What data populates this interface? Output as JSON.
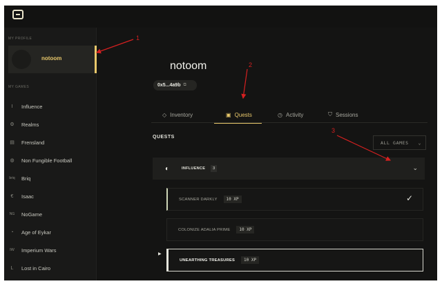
{
  "app": {
    "logo_icon": "game-console-icon"
  },
  "sidebar": {
    "profile_section_label": "MY PROFILE",
    "games_section_label": "MY GAMES",
    "profile": {
      "name": "notoom"
    },
    "games": [
      {
        "label": "Influence",
        "icon": "I"
      },
      {
        "label": "Realms",
        "icon": "⚙"
      },
      {
        "label": "Frensland",
        "icon": "▤"
      },
      {
        "label": "Non Fungible Football",
        "icon": "◍"
      },
      {
        "label": "Briq",
        "icon": "briq"
      },
      {
        "label": "Isaac",
        "icon": "€"
      },
      {
        "label": "NoGame",
        "icon": "NG"
      },
      {
        "label": "Age of Eykar",
        "icon": "◔"
      },
      {
        "label": "Imperium Wars",
        "icon": "IW"
      },
      {
        "label": "Lost in Cairo",
        "icon": "L"
      }
    ]
  },
  "main": {
    "username": "notoom",
    "wallet_address": "0x5...4a9b",
    "tabs": [
      {
        "label": "Inventory",
        "icon": "diamond-icon"
      },
      {
        "label": "Quests",
        "icon": "scroll-icon"
      },
      {
        "label": "Activity",
        "icon": "clock-icon"
      },
      {
        "label": "Sessions",
        "icon": "shield-icon"
      }
    ],
    "active_tab": "Quests",
    "quests_heading": "QUESTS",
    "filter_label": "ALL GAMES",
    "game_group": {
      "name": "INFLUENCE",
      "count": "3"
    },
    "quests": [
      {
        "name": "SCANNER DARKLY",
        "xp": "10 XP",
        "status": "completed"
      },
      {
        "name": "COLONIZE ADALIA PRIME",
        "xp": "10 XP",
        "status": "open"
      },
      {
        "name": "UNEARTHING TREASURES",
        "xp": "10 XP",
        "status": "selected"
      }
    ]
  },
  "annotations": {
    "color": "#d62020",
    "labels": [
      "1",
      "2",
      "3"
    ]
  }
}
